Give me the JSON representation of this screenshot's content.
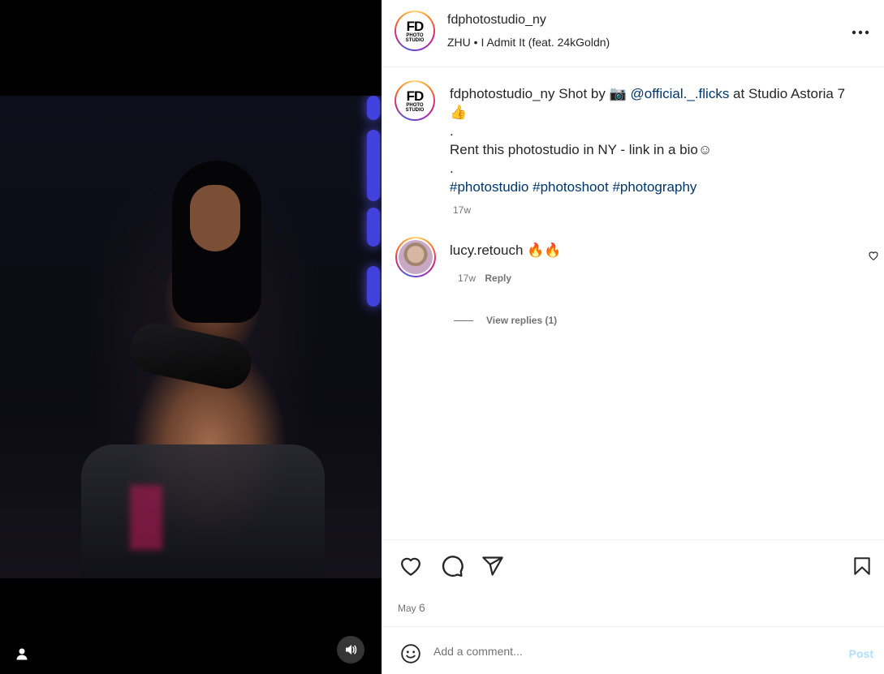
{
  "author": {
    "username": "fdphotostudio_ny",
    "audio": "ZHU • I Admit It (feat. 24kGoldn)",
    "logo_main": "FD",
    "logo_sub": "PHOTO STUDIO"
  },
  "caption": {
    "username": "fdphotostudio_ny",
    "text_before_mention": "Shot by 📷 ",
    "mention": "@official._.flicks",
    "text_after_mention": " at Studio Astoria 7👍",
    "dot1": ".",
    "line2": "Rent this photostudio in NY - link in a bio☺",
    "dot2": ".",
    "hashtags": [
      "#photostudio",
      "#photoshoot",
      "#photography"
    ],
    "time": "17w"
  },
  "comments": [
    {
      "username": "lucy.retouch",
      "text": "🔥🔥",
      "time": "17w",
      "reply_label": "Reply",
      "view_replies": "View replies (1)"
    }
  ],
  "post": {
    "date_month": "May",
    "date_day": "6"
  },
  "comment_box": {
    "placeholder": "Add a comment...",
    "post_label": "Post"
  },
  "icons": {
    "more": "more-options-icon",
    "like": "heart-icon",
    "comment": "comment-icon",
    "share": "share-icon",
    "save": "bookmark-icon",
    "emoji": "emoji-icon",
    "user_tag": "user-tag-icon",
    "mute": "speaker-icon"
  },
  "colors": {
    "link": "#00376b",
    "muted": "#737373",
    "post_disabled": "#b2dffc"
  }
}
